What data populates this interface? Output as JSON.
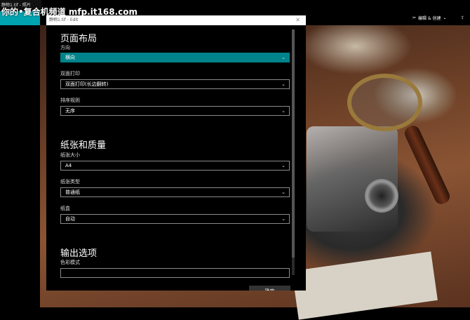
{
  "window": {
    "title": "静物1.tif - 照片",
    "watermark": "你的•复合机频道 mfp.it168.com"
  },
  "toolbar": {
    "edit_create_label": "编辑 & 创建"
  },
  "dialog": {
    "title": "静物1.tif - Edit",
    "sections": [
      {
        "heading": "页面布局"
      },
      {
        "heading": "纸张和质量"
      },
      {
        "heading": "输出选项"
      }
    ],
    "fields": {
      "orientation": {
        "label": "方向",
        "value": "横向"
      },
      "duplex": {
        "label": "双面打印",
        "value": "双面打印(长边翻转)"
      },
      "collation": {
        "label": "排序规则",
        "value": "无序"
      },
      "paper_size": {
        "label": "纸张大小",
        "value": "A4"
      },
      "paper_type": {
        "label": "纸张类型",
        "value": "普通纸"
      },
      "tray": {
        "label": "纸盒",
        "value": "自动"
      },
      "color_mode": {
        "label": "色彩模式",
        "value": ""
      }
    },
    "ok_label": "确定"
  },
  "colors": {
    "accent": "#00a3b0",
    "selected_field": "#00838a"
  }
}
